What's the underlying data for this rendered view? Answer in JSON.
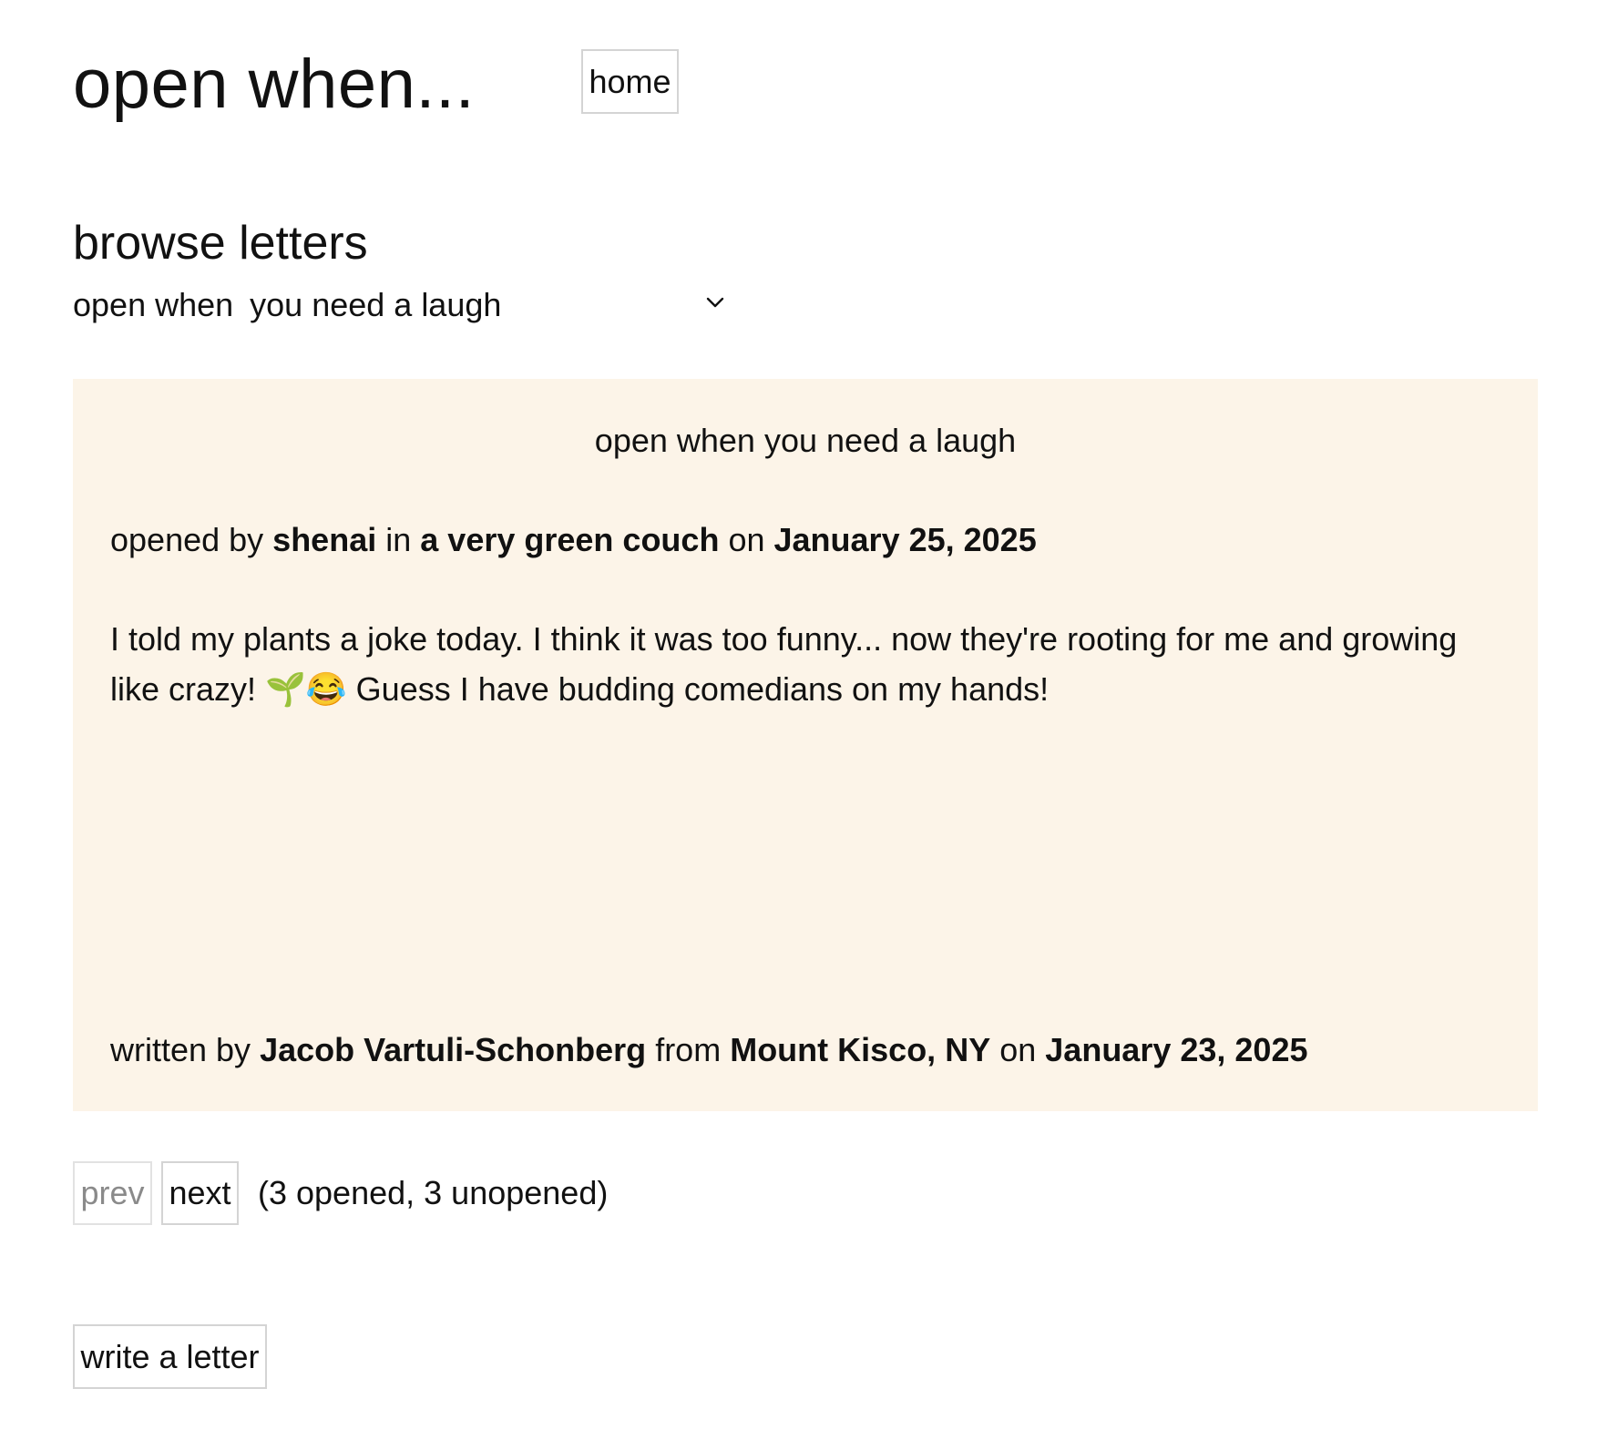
{
  "header": {
    "title": "open when...",
    "home_label": "home"
  },
  "browse": {
    "title": "browse letters",
    "filter_label": "open when",
    "selected_option": "you need a laugh",
    "chevron_icon": "chevron-down-icon"
  },
  "letter": {
    "heading": "open when you need a laugh",
    "opened": {
      "prefix": "opened by",
      "name": "shenai",
      "mid1": "in",
      "place": "a very green couch",
      "mid2": "on",
      "date": "January 25, 2025"
    },
    "body": "I told my plants a joke today. I think it was too funny... now they're rooting for me and growing like crazy! 🌱😂 Guess I have budding comedians on my hands!",
    "written": {
      "prefix": "written by",
      "author": "Jacob Vartuli-Schonberg",
      "mid1": "from",
      "location": "Mount Kisco, NY",
      "mid2": "on",
      "date": "January 23, 2025"
    },
    "card_color": "#fcf4e8"
  },
  "pager": {
    "prev_label": "prev",
    "next_label": "next",
    "status": "(3 opened, 3 unopened)"
  },
  "actions": {
    "write_label": "write a letter"
  }
}
